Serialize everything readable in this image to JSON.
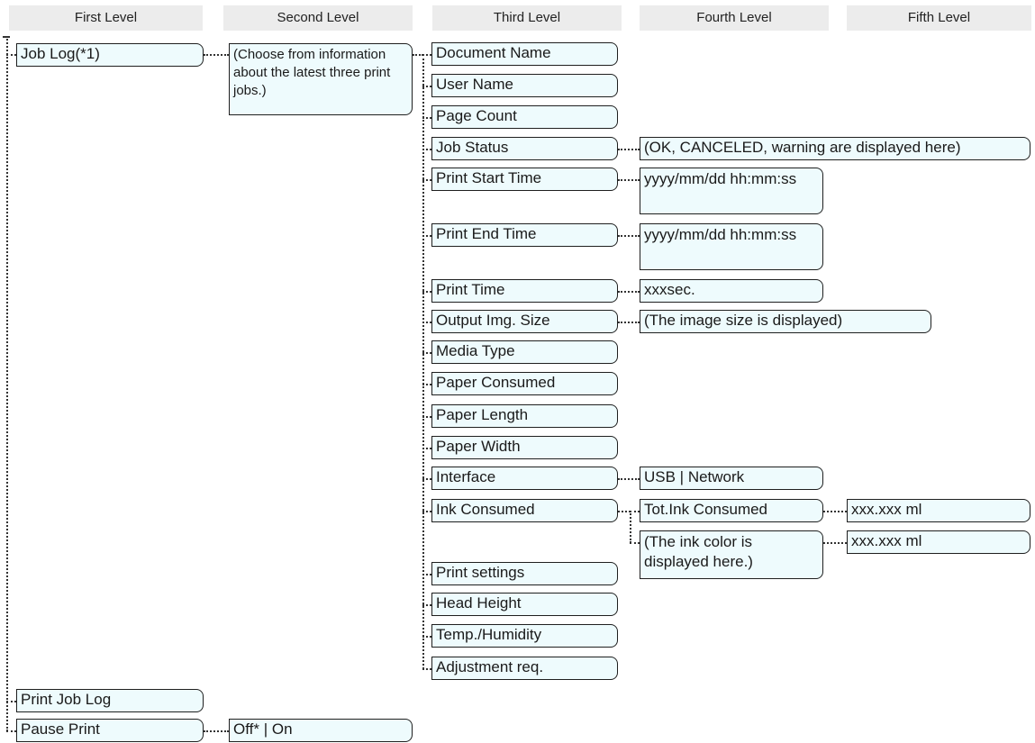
{
  "headers": [
    "First Level",
    "Second Level",
    "Third Level",
    "Fourth Level",
    "Fifth Level"
  ],
  "first_level": {
    "job_log": "Job Log(*1)",
    "print_job_log": "Print Job Log",
    "pause_print": "Pause Print"
  },
  "second_level": {
    "job_log_info": "(Choose from information about the latest three print jobs.)",
    "pause_print_value": "Off* | On"
  },
  "third_level": [
    "Document Name",
    "User Name",
    "Page Count",
    "Job Status",
    "Print Start Time",
    "Print End Time",
    "Print Time",
    "Output Img. Size",
    "Media Type",
    "Paper Consumed",
    "Paper Length",
    "Paper Width",
    "Interface",
    "Ink Consumed",
    "Print settings",
    "Head Height",
    "Temp./Humidity",
    "Adjustment req."
  ],
  "fourth_level": {
    "job_status": "(OK, CANCELED, warning are displayed here)",
    "print_start_time": "yyyy/mm/dd hh:mm:ss",
    "print_end_time": "yyyy/mm/dd hh:mm:ss",
    "print_time": "xxxsec.",
    "output_img_size": "(The image size is displayed)",
    "interface": "USB | Network",
    "tot_ink_consumed": "Tot.Ink Consumed",
    "ink_color": "(The ink color is displayed here.)"
  },
  "fifth_level": {
    "tot_ink_value": "xxx.xxx ml",
    "ink_color_value": "xxx.xxx ml"
  }
}
